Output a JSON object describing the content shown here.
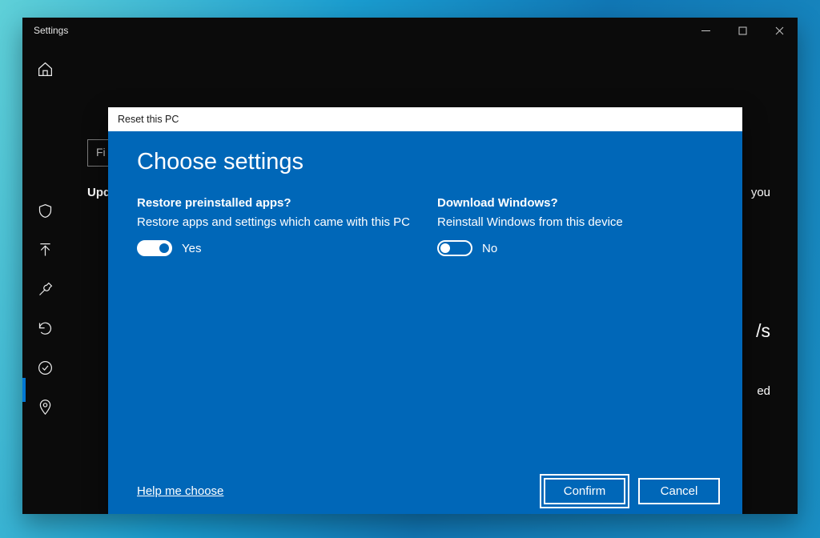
{
  "window": {
    "title": "Settings"
  },
  "bg": {
    "search_prefix": "Fi",
    "section_label": "Upd",
    "right1": "you",
    "right2": "/s",
    "right3": "ed"
  },
  "dialog": {
    "titlebar": "Reset this PC",
    "heading": "Choose settings",
    "options": [
      {
        "question": "Restore preinstalled apps?",
        "description": "Restore apps and settings which came with this PC",
        "toggle_label": "Yes",
        "on": true
      },
      {
        "question": "Download Windows?",
        "description": "Reinstall Windows from this device",
        "toggle_label": "No",
        "on": false
      }
    ],
    "help_link": "Help me choose",
    "buttons": {
      "confirm": "Confirm",
      "cancel": "Cancel"
    }
  },
  "colors": {
    "dialog_bg": "#0067b8",
    "accent": "#0078d4"
  }
}
